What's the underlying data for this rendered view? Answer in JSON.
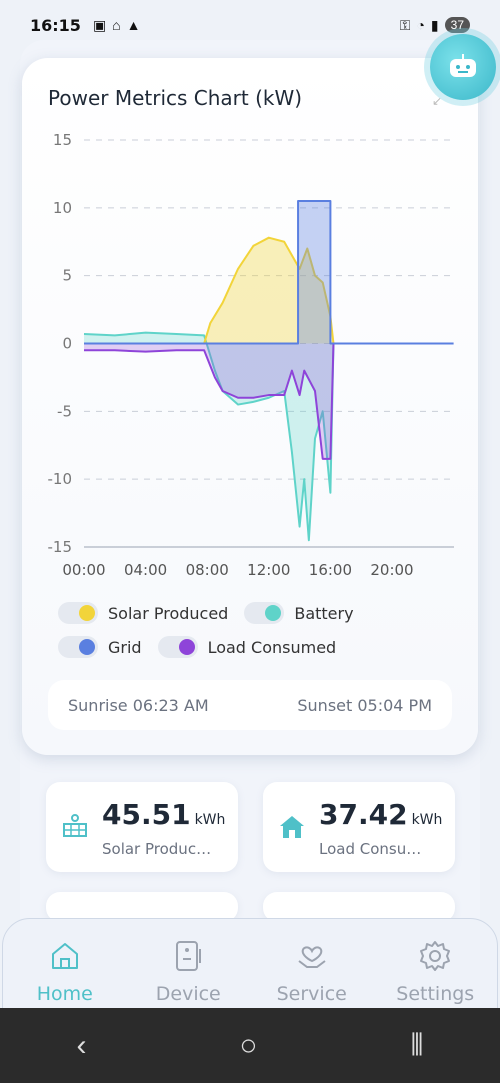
{
  "status_bar": {
    "time": "16:15",
    "battery": "37"
  },
  "chart_card": {
    "title": "Power Metrics Chart (kW)",
    "sunrise": "Sunrise 06:23 AM",
    "sunset": "Sunset 05:04 PM"
  },
  "legend": [
    {
      "label": "Solar Produced",
      "color": "#f2d43a"
    },
    {
      "label": "Battery",
      "color": "#5fd3c9"
    },
    {
      "label": "Grid",
      "color": "#5a7fe0"
    },
    {
      "label": "Load Consumed",
      "color": "#8e44d9"
    }
  ],
  "chart_data": {
    "type": "area",
    "y_ticks": [
      "15",
      "10",
      "5",
      "0",
      "-5",
      "-10",
      "-15"
    ],
    "x_ticks": [
      "00:00",
      "04:00",
      "08:00",
      "12:00",
      "16:00",
      "20:00"
    ],
    "ylim": [
      -15,
      15
    ],
    "xlim_hours": [
      0,
      24
    ],
    "grid": true,
    "series": [
      {
        "name": "Solar Produced",
        "color": "#f2d43a",
        "x": [
          0,
          7.8,
          8.2,
          9,
          10,
          11,
          12,
          13,
          14,
          14.5,
          15,
          15.5,
          16,
          16.2
        ],
        "y": [
          0,
          0,
          1.5,
          3,
          5.5,
          7.2,
          7.8,
          7.5,
          5.5,
          7,
          5,
          4.5,
          2,
          0
        ]
      },
      {
        "name": "Battery",
        "color": "#5fd3c9",
        "x": [
          0,
          2,
          4,
          6,
          7.8,
          8.5,
          9,
          10,
          11,
          12,
          13,
          13.5,
          14,
          14.3,
          14.6,
          15,
          15.5,
          16,
          16.2
        ],
        "y": [
          0.7,
          0.6,
          0.8,
          0.7,
          0.6,
          -2,
          -3.5,
          -4.5,
          -4.3,
          -4,
          -3.5,
          -8,
          -13.5,
          -10,
          -14.5,
          -7,
          -5,
          -11,
          0
        ]
      },
      {
        "name": "Grid",
        "color": "#5a7fe0",
        "x": [
          0,
          13.9,
          13.9,
          16.0,
          16.0,
          24
        ],
        "y": [
          0,
          0,
          10.5,
          10.5,
          0,
          0
        ]
      },
      {
        "name": "Load Consumed",
        "color": "#8e44d9",
        "x": [
          0,
          2,
          4,
          6,
          7.8,
          8.5,
          9,
          10,
          11,
          12,
          13,
          13.5,
          14,
          14.3,
          15,
          15.5,
          16,
          16.2
        ],
        "y": [
          -0.5,
          -0.5,
          -0.6,
          -0.5,
          -0.5,
          -2.5,
          -3.5,
          -4,
          -4,
          -3.8,
          -3.8,
          -2,
          -3.8,
          -2,
          -3.5,
          -8.5,
          -8.5,
          0
        ]
      }
    ]
  },
  "stats": [
    {
      "value": "45.51",
      "unit": "kWh",
      "label": "Solar Produc…",
      "icon": "solar-panel-icon"
    },
    {
      "value": "37.42",
      "unit": "kWh",
      "label": "Load Consu…",
      "icon": "house-icon"
    }
  ],
  "nav": [
    {
      "label": "Home",
      "icon": "home-icon",
      "active": true
    },
    {
      "label": "Device",
      "icon": "device-icon",
      "active": false
    },
    {
      "label": "Service",
      "icon": "service-icon",
      "active": false
    },
    {
      "label": "Settings",
      "icon": "gear-icon",
      "active": false
    }
  ]
}
